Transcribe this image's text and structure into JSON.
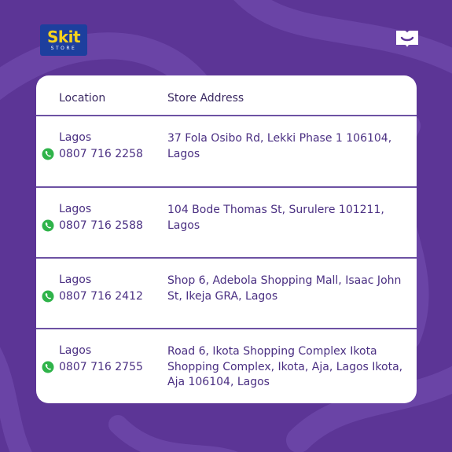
{
  "brand": {
    "logo_text": "Skit",
    "logo_subtext": "STORE",
    "logo_color": "#f7d21c",
    "logo_bg": "#1d3f9e",
    "corner_icon": "open-book-icon"
  },
  "colors": {
    "background": "#5c3596",
    "card": "#ffffff",
    "text": "#4a2f82",
    "phone_icon": "#2fb34a"
  },
  "table": {
    "headers": {
      "location": "Location",
      "address": "Store Address"
    },
    "rows": [
      {
        "city": "Lagos",
        "phone": "0807 716 2258",
        "address": "37 Fola Osibo Rd, Lekki Phase 1 106104, Lagos"
      },
      {
        "city": "Lagos",
        "phone": "0807 716 2588",
        "address": "104 Bode Thomas St, Surulere 101211, Lagos"
      },
      {
        "city": "Lagos",
        "phone": "0807 716 2412",
        "address": "Shop 6, Adebola Shopping Mall, Isaac John St, Ikeja GRA, Lagos"
      },
      {
        "city": "Lagos",
        "phone": "0807 716 2755",
        "address": "Road 6, Ikota Shopping Complex Ikota Shopping Complex, Ikota, Aja, Lagos Ikota, Aja 106104, Lagos"
      }
    ],
    "phone_icon": "whatsapp-phone-icon"
  }
}
